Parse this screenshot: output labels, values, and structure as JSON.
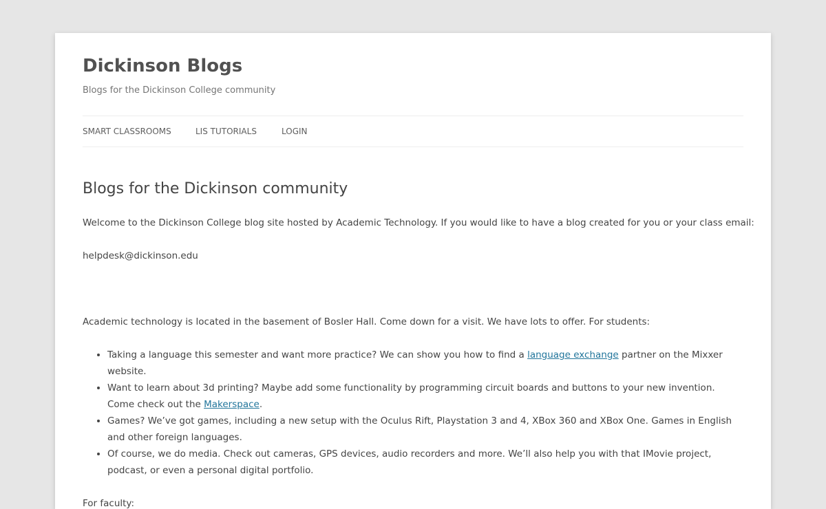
{
  "site": {
    "title": "Dickinson Blogs",
    "description": "Blogs for the Dickinson College community"
  },
  "nav": {
    "items": [
      {
        "label": "SMART CLASSROOMS"
      },
      {
        "label": "LIS TUTORIALS"
      },
      {
        "label": "LOGIN"
      }
    ]
  },
  "entry": {
    "title": "Blogs for the Dickinson community",
    "intro": "Welcome to the Dickinson College blog site hosted by Academic Technology. If you would like to have a blog created for you or your class email:",
    "email": "helpdesk@dickinson.edu",
    "location": "Academic technology is located in the basement of Bosler Hall.  Come down for a visit.  We have lots to offer. For students:",
    "students": [
      {
        "before": "Taking a language this semester and want more practice?  We can show you how to find a ",
        "link": "language exchange",
        "after": " partner on the Mixxer website."
      },
      {
        "before": "Want to learn about 3d printing?  Maybe add some functionality by programming circuit boards and buttons to your new invention.  Come check out the ",
        "link": "Makerspace",
        "after": "."
      },
      {
        "text": "Games?  We’ve got games, including a new setup with the Oculus Rift, Playstation 3 and 4, XBox 360 and XBox One.  Games in English and other foreign languages."
      },
      {
        "text": "Of course, we do media.  Check out cameras, GPS devices, audio recorders and more.  We’ll also help you with that IMovie project, podcast, or even a personal digital portfolio."
      }
    ],
    "faculty": "For faculty:"
  },
  "colors": {
    "background": "#e6e6e6",
    "page": "#ffffff",
    "link": "#21759b",
    "text": "#444444"
  }
}
